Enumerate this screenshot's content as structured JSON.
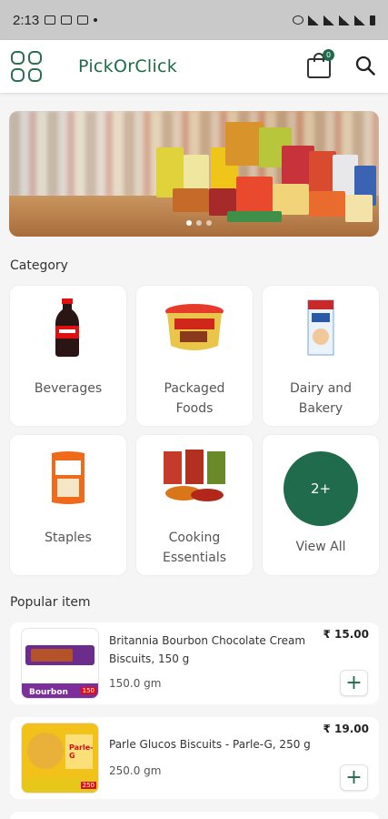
{
  "status_bar": {
    "time": "2:13"
  },
  "header": {
    "title": "PickOrClick",
    "cart_count": "0"
  },
  "sections": {
    "category_title": "Category",
    "popular_title": "Popular item"
  },
  "categories": [
    {
      "label": "Beverages",
      "icon": "soda-bottle-icon"
    },
    {
      "label": "Packaged Foods",
      "icon": "packaged-tub-icon"
    },
    {
      "label": "Dairy and Bakery",
      "icon": "milk-carton-icon"
    },
    {
      "label": "Staples",
      "icon": "rice-bag-icon"
    },
    {
      "label": "Cooking Essentials",
      "icon": "spices-icon"
    }
  ],
  "view_all": {
    "badge": "2+",
    "label": "View All"
  },
  "popular_items": [
    {
      "name": "Britannia Bourbon Chocolate Cream Biscuits, 150 g",
      "weight": "150.0 gm",
      "price": "₹ 15.00",
      "thumb_brand": "Bourbon",
      "thumb_tag": "150"
    },
    {
      "name": "Parle Glucos Biscuits - Parle-G, 250 g",
      "weight": "250.0 gm",
      "price": "₹ 19.00",
      "thumb_brand": "Parle-G",
      "thumb_tag": "250"
    }
  ],
  "add_button_symbol": "+",
  "colors": {
    "brand": "#1f6b4c",
    "status_bar": "#c9c9c9"
  }
}
